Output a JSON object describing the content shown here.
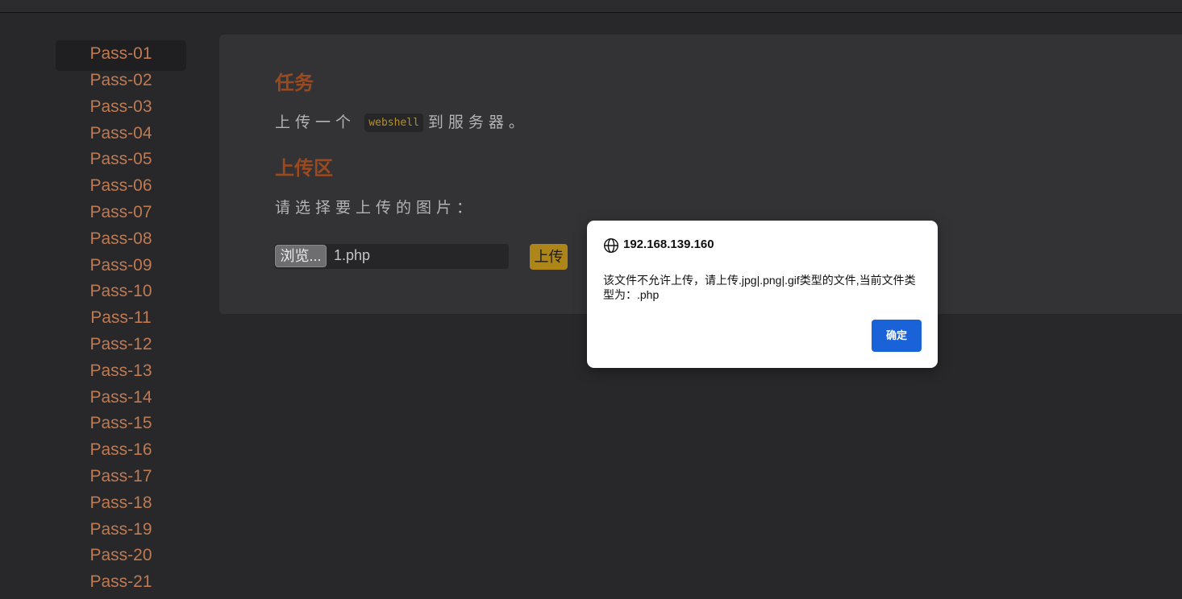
{
  "sidebar": {
    "items": [
      {
        "label": "Pass-01",
        "active": true
      },
      {
        "label": "Pass-02"
      },
      {
        "label": "Pass-03"
      },
      {
        "label": "Pass-04"
      },
      {
        "label": "Pass-05"
      },
      {
        "label": "Pass-06"
      },
      {
        "label": "Pass-07"
      },
      {
        "label": "Pass-08"
      },
      {
        "label": "Pass-09"
      },
      {
        "label": "Pass-10"
      },
      {
        "label": "Pass-11"
      },
      {
        "label": "Pass-12"
      },
      {
        "label": "Pass-13"
      },
      {
        "label": "Pass-14"
      },
      {
        "label": "Pass-15"
      },
      {
        "label": "Pass-16"
      },
      {
        "label": "Pass-17"
      },
      {
        "label": "Pass-18"
      },
      {
        "label": "Pass-19"
      },
      {
        "label": "Pass-20"
      },
      {
        "label": "Pass-21"
      }
    ]
  },
  "main": {
    "task_heading": "任务",
    "task_before": "上传一个",
    "task_code": "webshell",
    "task_after": "到服务器。",
    "upload_heading": "上传区",
    "upload_prompt": "请选择要上传的图片：",
    "browse_label": "浏览...",
    "file_name": "1.php",
    "upload_button": "上传"
  },
  "dialog": {
    "icon": "globe-icon",
    "host": "192.168.139.160",
    "message": "该文件不允许上传，请上传.jpg|.png|.gif类型的文件,当前文件类型为：.php",
    "ok_label": "确定"
  },
  "colors": {
    "background": "#28282b",
    "panel": "#333336",
    "link": "#bf7a52",
    "heading": "#9b4a1f",
    "upload_button": "#ad8518",
    "dialog_button": "#1a62d8"
  }
}
